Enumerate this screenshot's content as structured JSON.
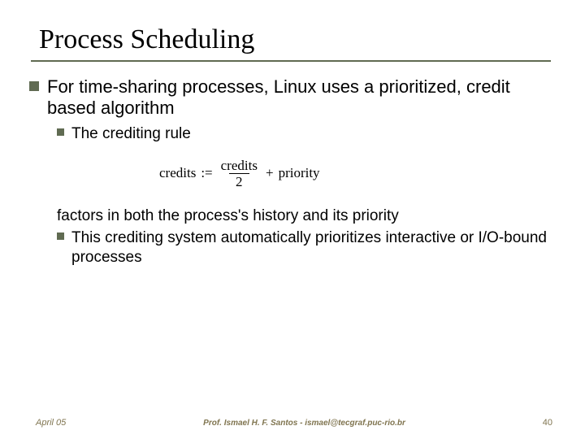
{
  "title": "Process Scheduling",
  "bullets": {
    "main": "For time-sharing processes, Linux uses a prioritized, credit based algorithm",
    "sub1": "The crediting rule",
    "continuation": "factors in both the process's history and its priority",
    "sub2": "This crediting system automatically prioritizes interactive or I/O-bound processes"
  },
  "formula": {
    "lhs": "credits",
    "assign": ":=",
    "numerator": "credits",
    "denominator": "2",
    "plus": "+",
    "rhs": "priority"
  },
  "footer": {
    "date": "April 05",
    "author": "Prof. Ismael H. F. Santos - ismael@tecgraf.puc-rio.br",
    "page": "40"
  },
  "chart_data": {
    "type": "table",
    "title": "Slide content (presentation slide, not a data chart)",
    "rows": [
      [
        "Heading",
        "Process Scheduling"
      ],
      [
        "Bullet L1",
        "For time-sharing processes, Linux uses a prioritized, credit based algorithm"
      ],
      [
        "Bullet L2",
        "The crediting rule"
      ],
      [
        "Formula",
        "credits := credits / 2 + priority"
      ],
      [
        "Bullet L2 cont.",
        "factors in both the process's history and its priority"
      ],
      [
        "Bullet L2",
        "This crediting system automatically prioritizes interactive or I/O-bound processes"
      ],
      [
        "Footer left",
        "April 05"
      ],
      [
        "Footer center",
        "Prof. Ismael H. F. Santos - ismael@tecgraf.puc-rio.br"
      ],
      [
        "Footer right",
        "40"
      ]
    ]
  }
}
